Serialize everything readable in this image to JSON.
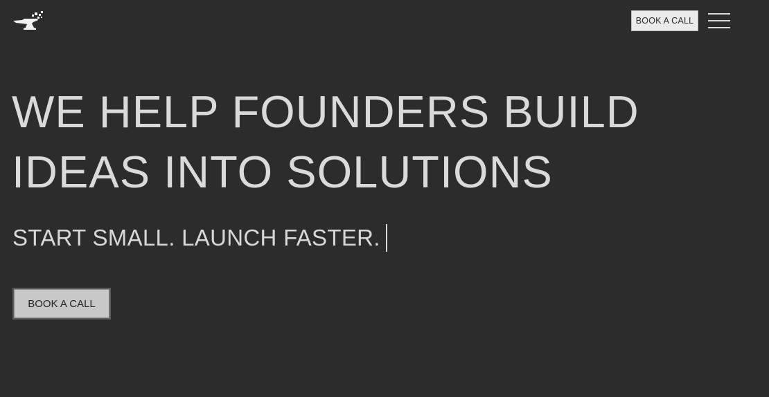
{
  "header": {
    "logo_icon": "anvil-logo-icon",
    "cta_label": "BOOK A CALL",
    "menu_icon": "hamburger-menu-icon"
  },
  "hero": {
    "title_line_1": "WE HELP FOUNDERS BUILD",
    "title_line_2": "IDEAS INTO SOLUTIONS",
    "tagline": "START SMALL. LAUNCH FASTER.",
    "cta_label": "BOOK A CALL"
  },
  "colors": {
    "background": "#2c2c2c",
    "text": "#d8d8d8",
    "button_light": "#ebebeb",
    "button_hero": "#c8c8c8"
  }
}
